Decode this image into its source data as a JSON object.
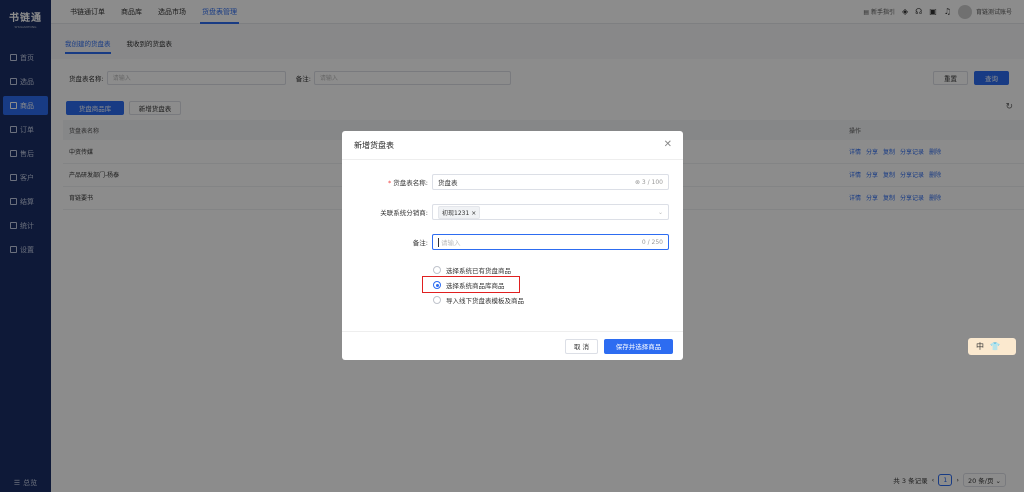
{
  "app": {
    "logo": "书链通",
    "logo_sub": "SHULIANTONG"
  },
  "sidebar": {
    "items": [
      {
        "label": "首页",
        "icon": "home-icon",
        "active": false
      },
      {
        "label": "选品",
        "icon": "select-icon",
        "active": false
      },
      {
        "label": "商品",
        "icon": "goods-icon",
        "active": true
      },
      {
        "label": "订单",
        "icon": "order-icon",
        "active": false
      },
      {
        "label": "售后",
        "icon": "aftersale-icon",
        "active": false
      },
      {
        "label": "客户",
        "icon": "customer-icon",
        "active": false
      },
      {
        "label": "结算",
        "icon": "settle-icon",
        "active": false
      },
      {
        "label": "统计",
        "icon": "stats-icon",
        "active": false
      },
      {
        "label": "设置",
        "icon": "settings-icon",
        "active": false
      }
    ],
    "bottom": "总览"
  },
  "topnav": {
    "items": [
      "书链通订单",
      "商品库",
      "选品市场",
      "货盘表管理"
    ],
    "active_index": 3
  },
  "topright": {
    "guide": "新手指引",
    "user": "育链测试账号"
  },
  "subtabs": [
    "我创建的货盘表",
    "我收到的货盘表"
  ],
  "search": {
    "name_label": "货盘表名称:",
    "name_placeholder": "请输入",
    "remark_label": "备注:",
    "remark_placeholder": "请输入",
    "reset": "重置",
    "query": "查询"
  },
  "toolbar": {
    "library_btn": "货盘商品库",
    "new_btn": "新增货盘表"
  },
  "table": {
    "headers": [
      "货盘表名称",
      "操作"
    ],
    "rows": [
      {
        "name": "中资传媒",
        "ops": [
          "详情",
          "分享",
          "复制",
          "分享记录",
          "删除"
        ]
      },
      {
        "name": "产品研发部门-杨泰",
        "ops": [
          "详情",
          "分享",
          "复制",
          "分享记录",
          "删除"
        ]
      },
      {
        "name": "育链要书",
        "ops": [
          "详情",
          "分享",
          "复制",
          "分享记录",
          "删除"
        ]
      }
    ]
  },
  "pager": {
    "total": "共 3 条记录",
    "page": "1",
    "size": "20 条/页"
  },
  "float_widget": {
    "lang": "中"
  },
  "modal": {
    "title": "新增货盘表",
    "name_label": "货盘表名称:",
    "name_value": "货盘表",
    "name_count": "3 / 100",
    "dist_label": "关联系统分销商:",
    "dist_tag": "初现1231",
    "remark_label": "备注:",
    "remark_placeholder": "请输入",
    "remark_count": "0 / 250",
    "options": [
      "选择系统已有货盘商品",
      "选择系统商品库商品",
      "导入线下货盘表模板及商品"
    ],
    "selected_option": 1,
    "cancel": "取 消",
    "save": "保存并选择商品"
  },
  "colors": {
    "primary": "#2d6cf1",
    "sidebar": "#1b2f66",
    "highlight": "#e02020"
  }
}
